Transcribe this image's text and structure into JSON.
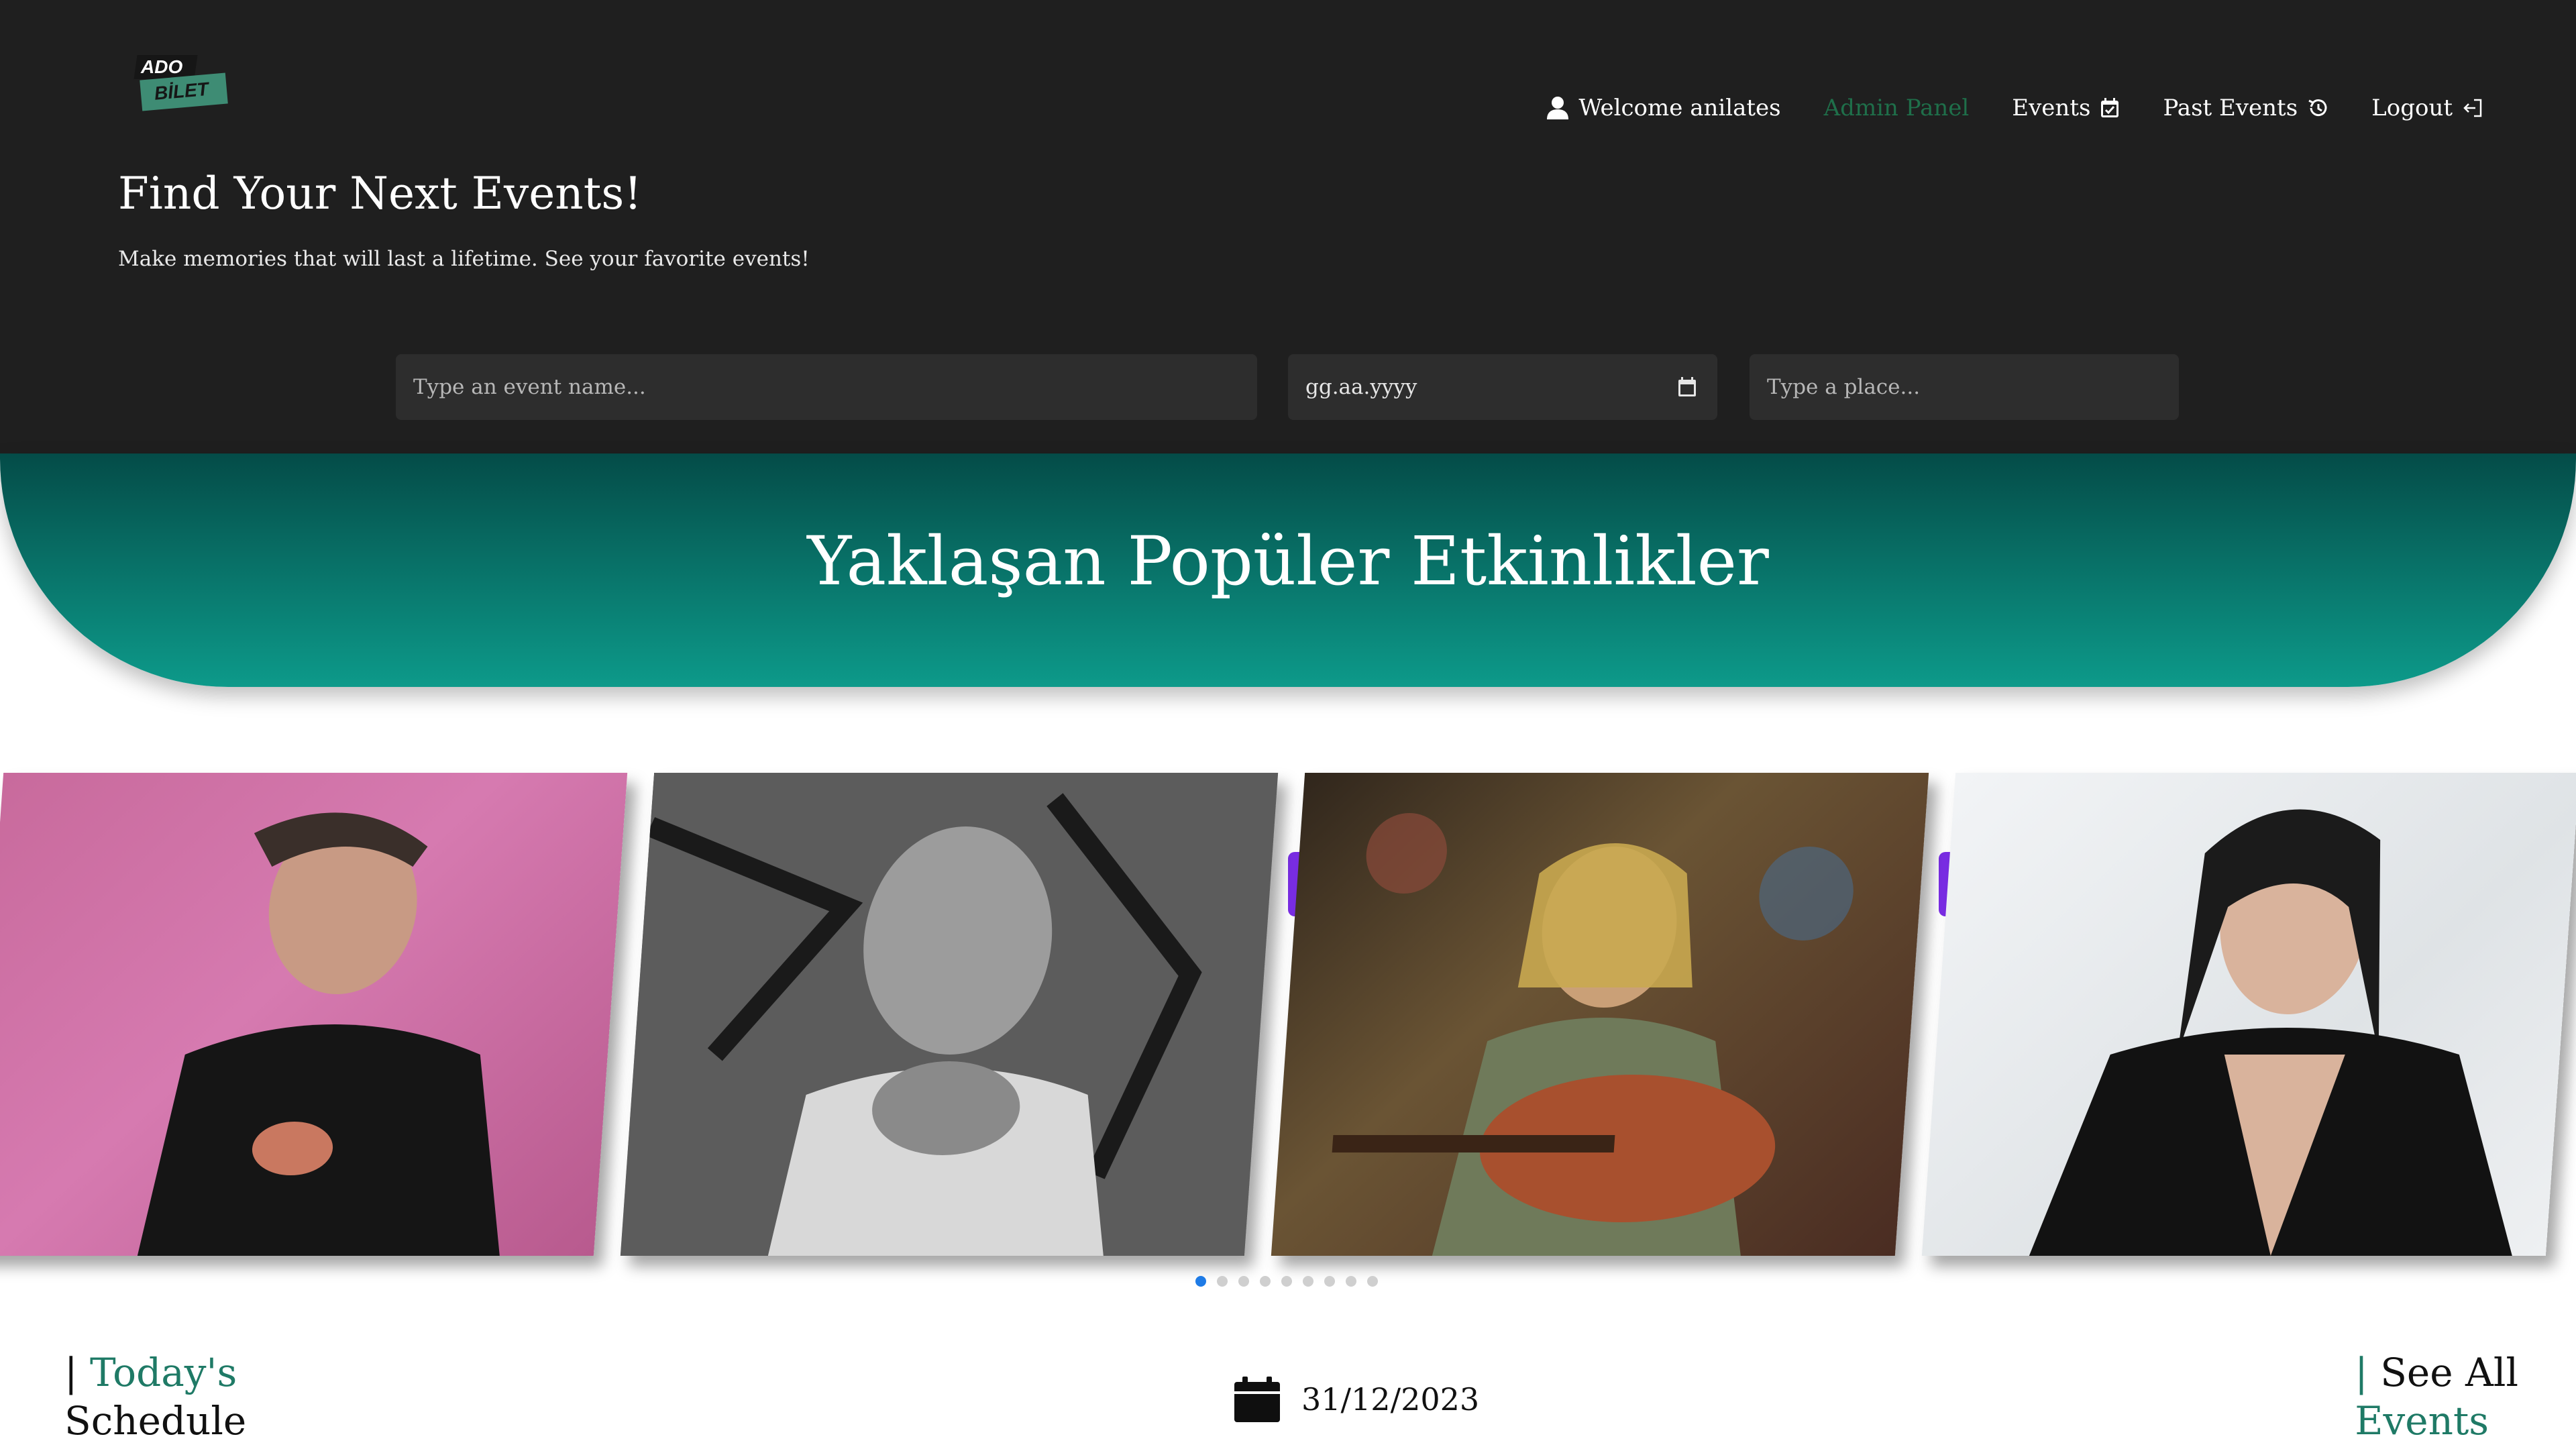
{
  "logo": {
    "top": "ADO",
    "bottom": "BİLET"
  },
  "nav": {
    "welcome": "Welcome anilates",
    "admin": "Admin Panel",
    "events": "Events",
    "past_events": "Past Events",
    "logout": "Logout"
  },
  "hero": {
    "title": "Find Your Next Events!",
    "subtitle": "Make memories that will last a lifetime. See your favorite events!"
  },
  "search": {
    "event_placeholder": "Type an event name...",
    "date_placeholder": "gg.aa.yyyy",
    "place_placeholder": "Type a place..."
  },
  "band": {
    "title": "Yaklaşan Popüler Etkinlikler"
  },
  "carousel": {
    "cards": 4,
    "dots": 9,
    "active_dot": 0
  },
  "schedule": {
    "bar": "|",
    "today_highlight": "Today's",
    "today_rest": "Schedule",
    "date": "31/12/2023",
    "see_all_highlight": "See All",
    "see_all_rest": "Events"
  },
  "colors": {
    "header_bg": "#1f1f1f",
    "teal": "#0d9a8a",
    "accent_green": "#1f7a66",
    "dot_active": "#1e7be6"
  }
}
